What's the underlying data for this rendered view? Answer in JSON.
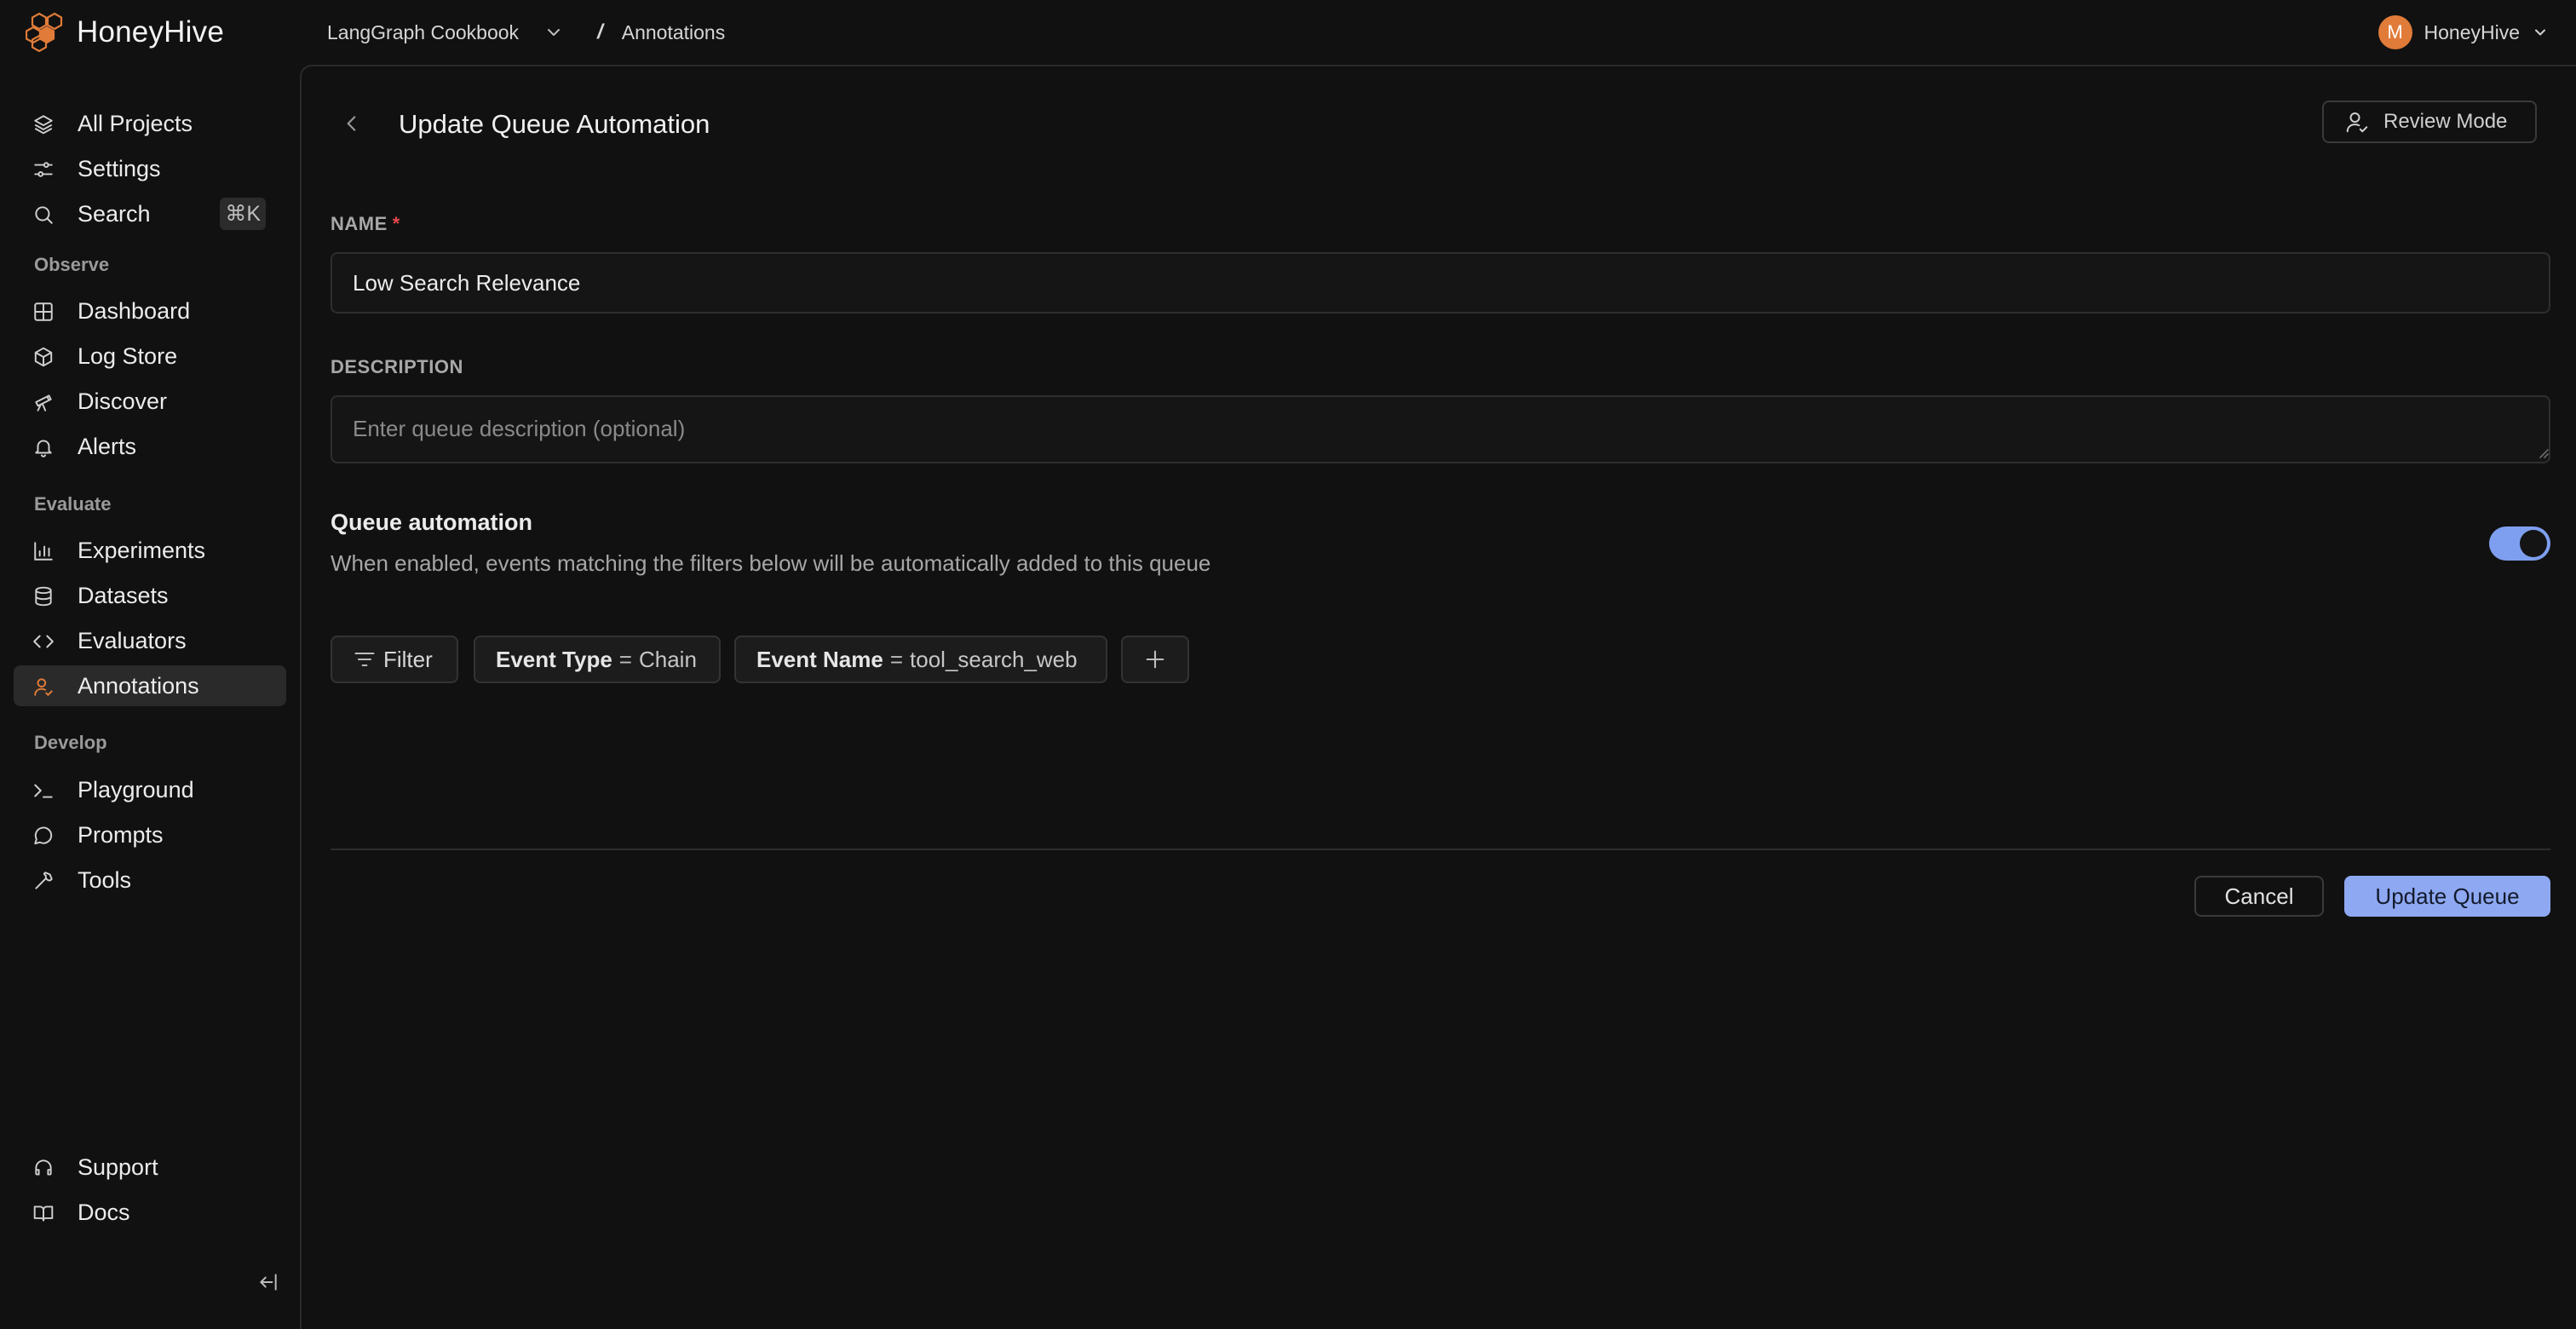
{
  "brand": {
    "name": "HoneyHive",
    "icon": "honeycomb-logo-icon",
    "accent": "#e07b39"
  },
  "breadcrumb": {
    "project": "LangGraph Cookbook",
    "separator": "/",
    "page": "Annotations"
  },
  "user": {
    "initial": "M",
    "org": "HoneyHive"
  },
  "sidebar": {
    "top": [
      {
        "label": "All Projects",
        "icon": "layers-icon"
      },
      {
        "label": "Settings",
        "icon": "sliders-icon"
      },
      {
        "label": "Search",
        "icon": "search-icon",
        "shortcut": "⌘K"
      }
    ],
    "sections": {
      "observe": {
        "title": "Observe",
        "items": [
          {
            "label": "Dashboard",
            "icon": "grid-icon"
          },
          {
            "label": "Log Store",
            "icon": "box-icon"
          },
          {
            "label": "Discover",
            "icon": "telescope-icon"
          },
          {
            "label": "Alerts",
            "icon": "bell-icon"
          }
        ]
      },
      "evaluate": {
        "title": "Evaluate",
        "items": [
          {
            "label": "Experiments",
            "icon": "bar-chart-icon"
          },
          {
            "label": "Datasets",
            "icon": "database-icon"
          },
          {
            "label": "Evaluators",
            "icon": "code-icon"
          },
          {
            "label": "Annotations",
            "icon": "user-check-icon",
            "active": true
          }
        ]
      },
      "develop": {
        "title": "Develop",
        "items": [
          {
            "label": "Playground",
            "icon": "terminal-icon"
          },
          {
            "label": "Prompts",
            "icon": "message-circle-icon"
          },
          {
            "label": "Tools",
            "icon": "wrench-icon"
          }
        ]
      }
    },
    "bottom": [
      {
        "label": "Support",
        "icon": "headset-icon"
      },
      {
        "label": "Docs",
        "icon": "book-icon"
      }
    ]
  },
  "main": {
    "title": "Update Queue Automation",
    "review_mode_label": "Review Mode",
    "name_label": "NAME",
    "name_required_mark": "*",
    "name_value": "Low Search Relevance",
    "description_label": "DESCRIPTION",
    "description_placeholder": "Enter queue description (optional)",
    "automation_title": "Queue automation",
    "automation_description": "When enabled, events matching the filters below will be automatically added to this queue",
    "automation_enabled": true,
    "filter_label": "Filter",
    "filters": [
      {
        "field": "Event Type",
        "op": "=",
        "value": "Chain"
      },
      {
        "field": "Event Name",
        "op": "=",
        "value": "tool_search_web"
      }
    ],
    "cancel_label": "Cancel",
    "submit_label": "Update Queue",
    "toggle_color": "#7e9fef",
    "submit_color": "#8ea9f2"
  }
}
